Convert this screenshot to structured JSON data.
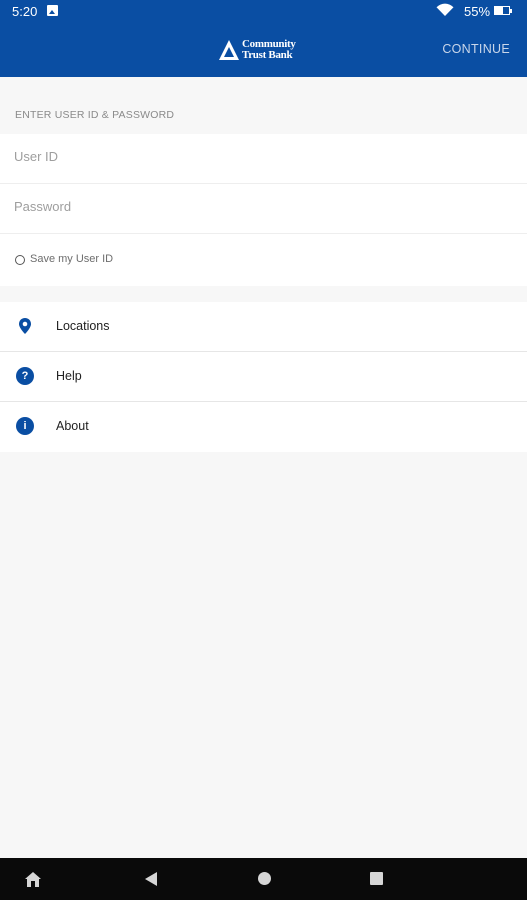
{
  "status_bar": {
    "time": "5:20",
    "battery_percent": "55%",
    "icons": [
      "image-icon",
      "wifi-icon",
      "battery-icon"
    ]
  },
  "app_bar": {
    "logo_line1": "Community",
    "logo_line2": "Trust Bank",
    "continue_label": "CONTINUE"
  },
  "login": {
    "section_label": "ENTER USER ID & PASSWORD",
    "user_id_placeholder": "User ID",
    "user_id_value": "",
    "password_placeholder": "Password",
    "password_value": "",
    "save_label": "Save my User ID",
    "save_checked": false
  },
  "menu": {
    "items": [
      {
        "label": "Locations",
        "icon": "location-pin-icon"
      },
      {
        "label": "Help",
        "icon": "help-icon"
      },
      {
        "label": "About",
        "icon": "info-icon"
      }
    ]
  },
  "nav_bar": {
    "icons": [
      "home-icon",
      "back-icon",
      "home-circle-icon",
      "recents-icon"
    ]
  },
  "colors": {
    "brand": "#0a4ea3",
    "background": "#f7f7f7",
    "continue_text": "#c9d6ea"
  }
}
